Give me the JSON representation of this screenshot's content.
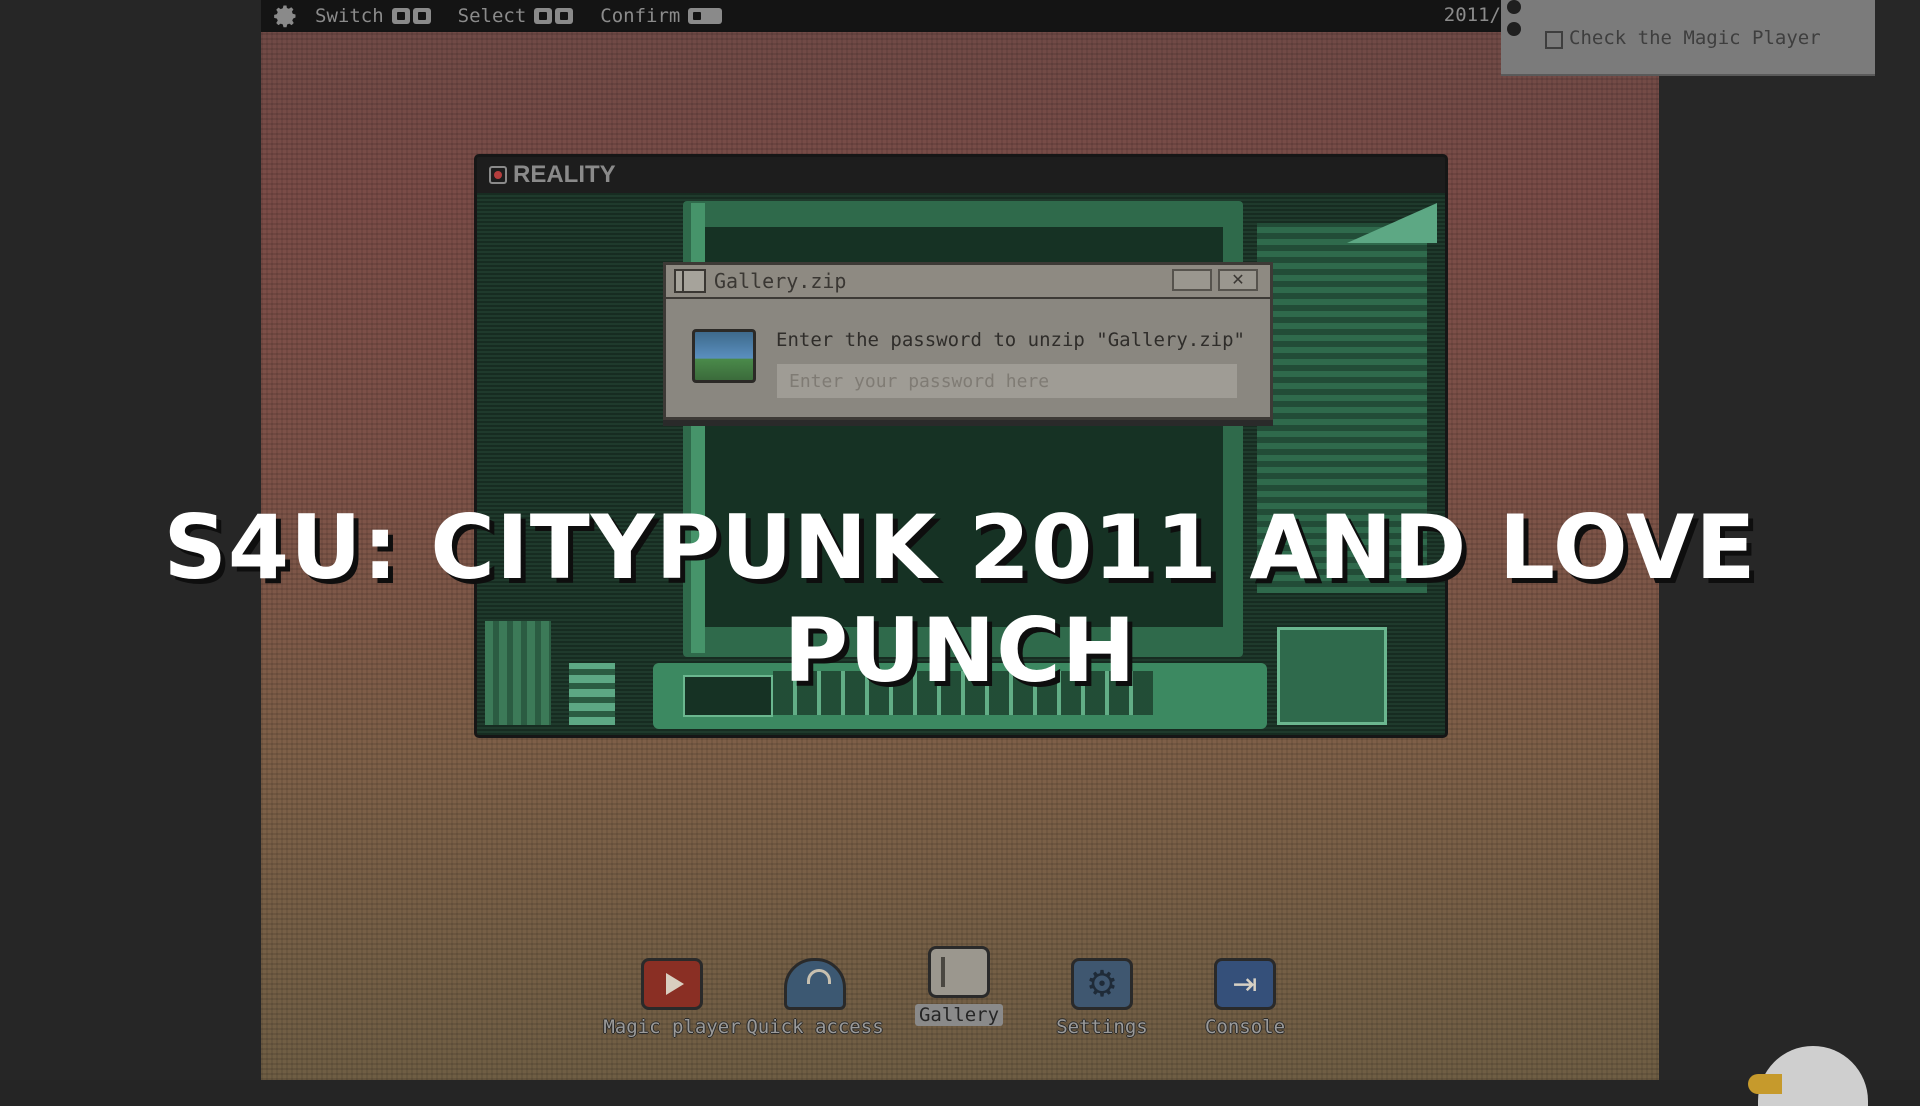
{
  "topbar": {
    "hints": [
      {
        "label": "Switch",
        "keys": [
          "l1",
          "r1"
        ]
      },
      {
        "label": "Select",
        "keys": [
          "up",
          "down"
        ]
      },
      {
        "label": "Confirm",
        "keys": [
          "enter"
        ]
      }
    ],
    "clock": "2011/"
  },
  "task": {
    "label": "Check the Magic Player",
    "checked": false
  },
  "reality_window": {
    "title": "REALITY"
  },
  "dialog": {
    "title": "Gallery.zip",
    "close_label": "✕",
    "prompt": "Enter the password to unzip \"Gallery.zip\"",
    "password_placeholder": "Enter your password here",
    "password_value": ""
  },
  "headline": "S4U: CITYPUNK 2011 AND LOVE PUNCH",
  "dock": {
    "items": [
      {
        "label": "Magic player",
        "icon": "play-icon"
      },
      {
        "label": "Quick access",
        "icon": "cloud-icon"
      },
      {
        "label": "Gallery",
        "icon": "gallery-icon",
        "active": true
      },
      {
        "label": "Settings",
        "icon": "gear-icon"
      },
      {
        "label": "Console",
        "icon": "exit-icon"
      }
    ]
  },
  "colors": {
    "background": "#252525",
    "topbar": "#141414",
    "reality_green": "#2f6a4b",
    "dialog_bg": "#8a8780"
  }
}
